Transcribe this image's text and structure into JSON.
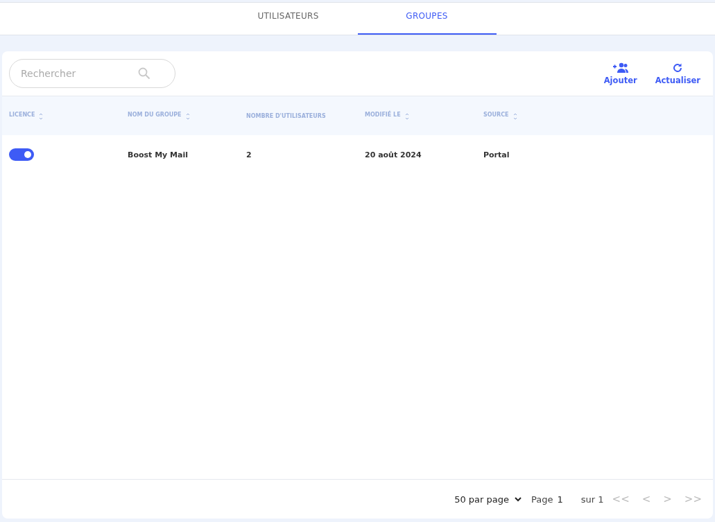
{
  "tabs": [
    {
      "label": "UTILISATEURS",
      "selected": false
    },
    {
      "label": "GROUPES",
      "selected": true
    }
  ],
  "search": {
    "placeholder": "Rechercher"
  },
  "actions": [
    {
      "kind": "add-user",
      "label": "Ajouter"
    },
    {
      "kind": "refresh",
      "label": "Actualiser"
    }
  ],
  "table": {
    "columns": [
      {
        "label": "LICENCE",
        "sortable": true
      },
      {
        "label": "NOM DU GROUPE",
        "sortable": true
      },
      {
        "label": "NOMBRE D'UTILISATEURS",
        "sortable": false
      },
      {
        "label": "MODIFIÉ LE",
        "sortable": true
      },
      {
        "label": "SOURCE",
        "sortable": true
      }
    ],
    "rows": [
      {
        "cells": [
          {
            "kind": "toggle",
            "on": true
          },
          {
            "kind": "text",
            "text": "Boost My Mail"
          },
          {
            "kind": "text",
            "text": "2"
          },
          {
            "kind": "text",
            "text": "20 août 2024"
          },
          {
            "kind": "text",
            "text": "Portal"
          }
        ]
      }
    ]
  },
  "pagination": {
    "page_size": "50 par page",
    "page_label": "Page",
    "page": "1",
    "total": "sur 1",
    "nav": [
      {
        "label": "<<",
        "disabled": true
      },
      {
        "label": "<",
        "disabled": true
      },
      {
        "label": ">",
        "disabled": true
      },
      {
        "label": ">>",
        "disabled": true
      }
    ]
  }
}
